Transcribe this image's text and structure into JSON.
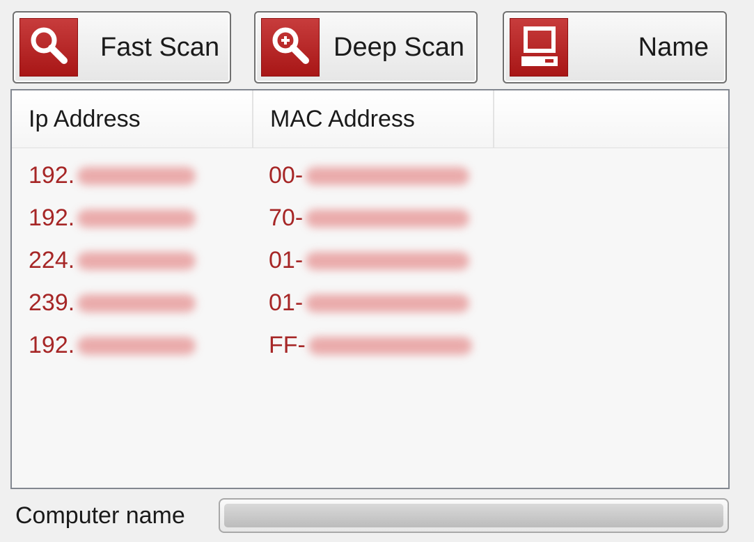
{
  "toolbar": {
    "fast_scan_label": "Fast Scan",
    "deep_scan_label": "Deep Scan",
    "name_label": "Name",
    "icon_color": "#b52222",
    "icons": [
      "magnifier-icon",
      "magnifier-plus-icon",
      "computer-icon"
    ]
  },
  "list": {
    "columns": [
      "Ip Address",
      "MAC Address",
      ""
    ],
    "text_color": "#a62626",
    "rows": [
      {
        "ip": "192.",
        "mac": "00-"
      },
      {
        "ip": "192.",
        "mac": "70-"
      },
      {
        "ip": "224.",
        "mac": "01-"
      },
      {
        "ip": "239.",
        "mac": "01-"
      },
      {
        "ip": "192.",
        "mac": "FF-"
      }
    ]
  },
  "footer": {
    "computer_name_label": "Computer name",
    "progress": 0
  }
}
